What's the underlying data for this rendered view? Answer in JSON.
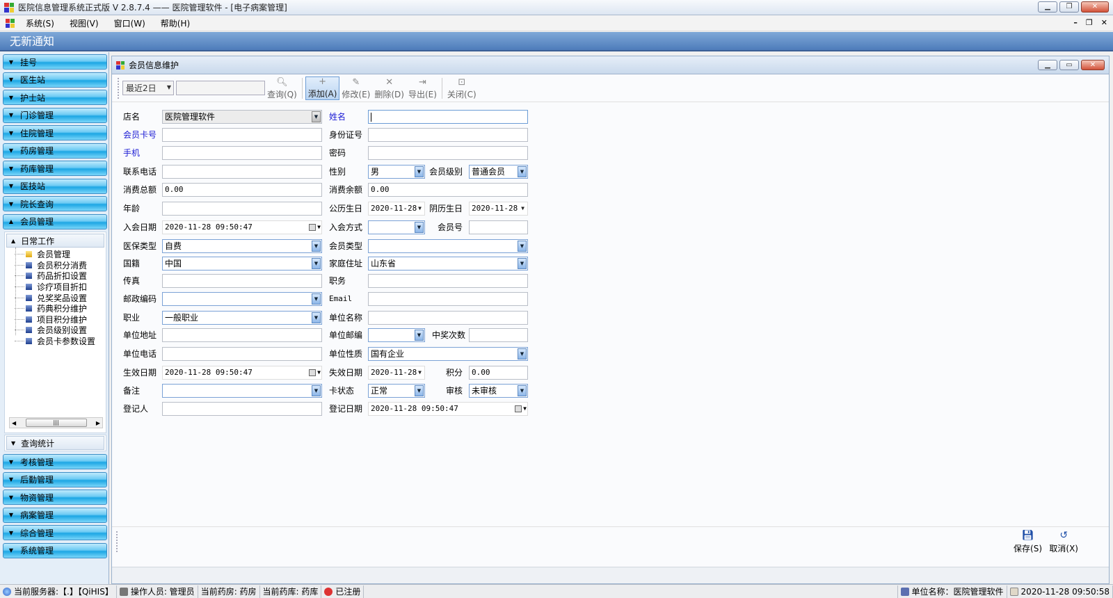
{
  "window": {
    "title": "医院信息管理系统正式版 V 2.8.7.4 —— 医院管理软件 - [电子病案管理]"
  },
  "menu": {
    "items": [
      "系统(S)",
      "视图(V)",
      "窗口(W)",
      "帮助(H)"
    ]
  },
  "notice": {
    "text": "无新通知"
  },
  "sidebar": {
    "top_items": [
      "挂号",
      "医生站",
      "护士站",
      "门诊管理",
      "住院管理",
      "药房管理",
      "药库管理",
      "医技站",
      "院长查询",
      "会员管理"
    ],
    "tree_header": "日常工作",
    "tree_items": [
      "会员管理",
      "会员积分消费",
      "药品折扣设置",
      "诊疗项目折扣",
      "兑奖奖品设置",
      "药典积分维护",
      "项目积分维护",
      "会员级别设置",
      "会员卡参数设置"
    ],
    "tree_header2": "查询统计",
    "bottom_items": [
      "考核管理",
      "后勤管理",
      "物资管理",
      "病案管理",
      "综合管理",
      "系统管理"
    ]
  },
  "child_window": {
    "title": "会员信息维护"
  },
  "toolbar": {
    "range_value": "最近2日",
    "search_value": "",
    "query_label": "查询(Q)",
    "add_label": "添加(A)",
    "edit_label": "修改(E)",
    "delete_label": "删除(D)",
    "export_label": "导出(E)",
    "close_label": "关闭(C)"
  },
  "form": {
    "shop_name": {
      "label": "店名",
      "value": "医院管理软件"
    },
    "name": {
      "label": "姓名",
      "value": ""
    },
    "card_no": {
      "label": "会员卡号",
      "value": ""
    },
    "id_no": {
      "label": "身份证号",
      "value": ""
    },
    "mobile": {
      "label": "手机",
      "value": ""
    },
    "password": {
      "label": "密码",
      "value": ""
    },
    "phone": {
      "label": "联系电话",
      "value": ""
    },
    "gender": {
      "label": "性别",
      "value": "男"
    },
    "level": {
      "label": "会员级别",
      "value": "普通会员"
    },
    "total_spent": {
      "label": "消费总额",
      "value": "0.00"
    },
    "balance": {
      "label": "消费余额",
      "value": "0.00"
    },
    "age": {
      "label": "年龄",
      "value": ""
    },
    "solar_birthday": {
      "label": "公历生日",
      "value": "2020-11-28"
    },
    "lunar_birthday": {
      "label": "阴历生日",
      "value": "2020-11-28"
    },
    "join_date": {
      "label": "入会日期",
      "value": "2020-11-28 09:50:47"
    },
    "join_method": {
      "label": "入会方式",
      "value": ""
    },
    "member_no": {
      "label": "会员号",
      "value": ""
    },
    "insurance_type": {
      "label": "医保类型",
      "value": "自费"
    },
    "member_type": {
      "label": "会员类型",
      "value": ""
    },
    "nationality": {
      "label": "国籍",
      "value": "中国"
    },
    "home_address": {
      "label": "家庭住址",
      "value": "山东省"
    },
    "fax": {
      "label": "传真",
      "value": ""
    },
    "position": {
      "label": "职务",
      "value": ""
    },
    "postcode": {
      "label": "邮政编码",
      "value": ""
    },
    "email": {
      "label": "Email",
      "value": ""
    },
    "occupation": {
      "label": "职业",
      "value": "一般职业"
    },
    "company_name": {
      "label": "单位名称",
      "value": ""
    },
    "company_address": {
      "label": "单位地址",
      "value": ""
    },
    "company_postcode": {
      "label": "单位邮编",
      "value": ""
    },
    "prize_count": {
      "label": "中奖次数",
      "value": ""
    },
    "company_phone": {
      "label": "单位电话",
      "value": ""
    },
    "company_nature": {
      "label": "单位性质",
      "value": "国有企业"
    },
    "effective_date": {
      "label": "生效日期",
      "value": "2020-11-28 09:50:47"
    },
    "expiry_date": {
      "label": "失效日期",
      "value": "2020-11-28"
    },
    "points": {
      "label": "积分",
      "value": "0.00"
    },
    "remark": {
      "label": "备注",
      "value": ""
    },
    "card_status": {
      "label": "卡状态",
      "value": "正常"
    },
    "audit": {
      "label": "审核",
      "value": "未审核"
    },
    "registrar": {
      "label": "登记人",
      "value": ""
    },
    "register_date": {
      "label": "登记日期",
      "value": "2020-11-28 09:50:47"
    }
  },
  "actions": {
    "save_label": "保存(S)",
    "cancel_label": "取消(X)"
  },
  "status": {
    "server": "当前服务器:【.】【QiHIS】",
    "operator": "操作人员: 管理员",
    "pharmacy": "当前药房: 药房",
    "warehouse": "当前药库: 药库",
    "registered": "已注册",
    "unit": "单位名称：医院管理软件",
    "datetime": "2020-11-28 09:50:58"
  }
}
